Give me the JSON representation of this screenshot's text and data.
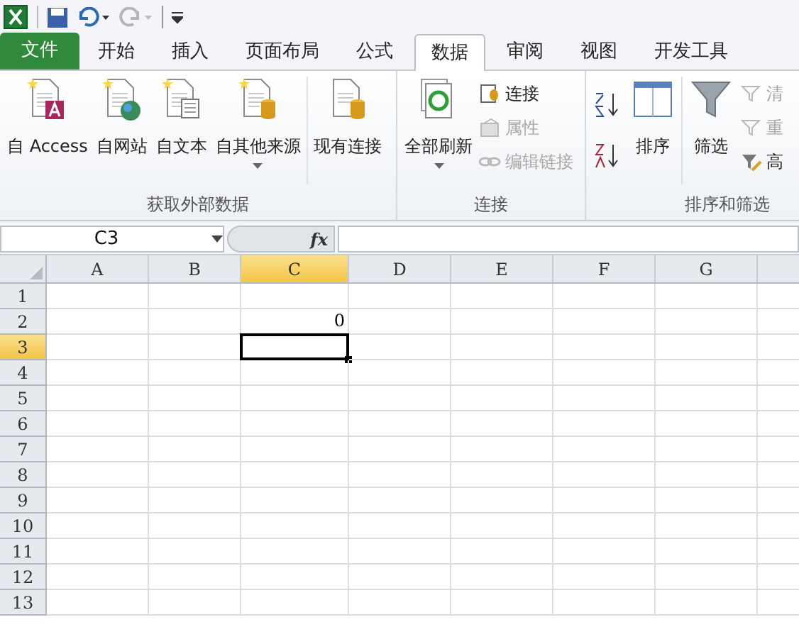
{
  "tabs": [
    {
      "label": "文件",
      "kind": "file",
      "selected": false
    },
    {
      "label": "开始",
      "kind": "tab",
      "selected": false
    },
    {
      "label": "插入",
      "kind": "tab",
      "selected": false
    },
    {
      "label": "页面布局",
      "kind": "tab",
      "selected": false
    },
    {
      "label": "公式",
      "kind": "tab",
      "selected": false
    },
    {
      "label": "数据",
      "kind": "tab",
      "selected": true
    },
    {
      "label": "审阅",
      "kind": "tab",
      "selected": false
    },
    {
      "label": "视图",
      "kind": "tab",
      "selected": false
    },
    {
      "label": "开发工具",
      "kind": "tab",
      "selected": false
    }
  ],
  "ribbon_groups": [
    {
      "title": "获取外部数据",
      "items": [
        {
          "kind": "large",
          "label": "自 Access",
          "dropdown": false,
          "disabled": false
        },
        {
          "kind": "large",
          "label": "自网站",
          "dropdown": false,
          "disabled": false
        },
        {
          "kind": "large",
          "label": "自文本",
          "dropdown": false,
          "disabled": false
        },
        {
          "kind": "large",
          "label": "自其他来源",
          "dropdown": true,
          "disabled": false
        },
        {
          "kind": "separator"
        },
        {
          "kind": "large",
          "label": "现有连接",
          "dropdown": false,
          "disabled": false
        }
      ]
    },
    {
      "title": "连接",
      "items": [
        {
          "kind": "large",
          "label": "全部刷新",
          "dropdown": true,
          "disabled": false
        },
        {
          "kind": "stack",
          "buttons": [
            {
              "label": "连接",
              "disabled": false
            },
            {
              "label": "属性",
              "disabled": true
            },
            {
              "label": "编辑链接",
              "disabled": true
            }
          ]
        }
      ]
    },
    {
      "title": "排序和筛选",
      "items": [
        {
          "kind": "sorticons"
        },
        {
          "kind": "large",
          "label": "排序",
          "dropdown": false,
          "disabled": false
        },
        {
          "kind": "separator"
        },
        {
          "kind": "large",
          "label": "筛选",
          "dropdown": false,
          "disabled": false
        },
        {
          "kind": "stack",
          "buttons": [
            {
              "label": "清",
              "disabled": true
            },
            {
              "label": "重",
              "disabled": true
            },
            {
              "label": "高",
              "disabled": false
            }
          ]
        }
      ]
    }
  ],
  "formula_bar": {
    "name_box": "C3",
    "fx": "fx"
  },
  "sheet": {
    "columns": [
      {
        "label": "A",
        "selected": false
      },
      {
        "label": "B",
        "selected": false
      },
      {
        "label": "C",
        "selected": true
      },
      {
        "label": "D",
        "selected": false
      },
      {
        "label": "E",
        "selected": false
      },
      {
        "label": "F",
        "selected": false
      },
      {
        "label": "G",
        "selected": false
      }
    ],
    "rows": [
      {
        "label": "1",
        "selected": false
      },
      {
        "label": "2",
        "selected": false,
        "cells": [
          null,
          null,
          "0"
        ]
      },
      {
        "label": "3",
        "selected": true
      },
      {
        "label": "4",
        "selected": false
      },
      {
        "label": "5",
        "selected": false
      },
      {
        "label": "6",
        "selected": false
      },
      {
        "label": "7",
        "selected": false
      },
      {
        "label": "8",
        "selected": false
      },
      {
        "label": "9",
        "selected": false
      },
      {
        "label": "10",
        "selected": false
      },
      {
        "label": "11",
        "selected": false
      },
      {
        "label": "12",
        "selected": false
      },
      {
        "label": "13",
        "selected": false
      }
    ]
  }
}
